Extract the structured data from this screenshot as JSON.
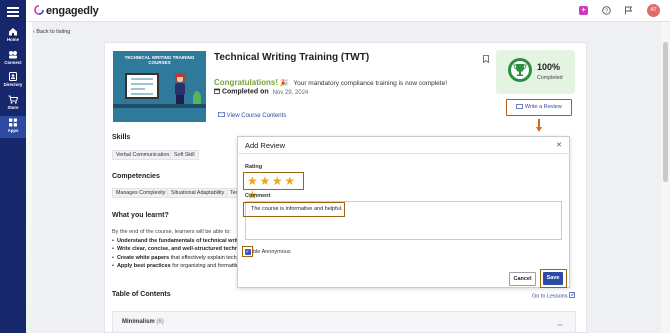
{
  "nav": {
    "items": [
      {
        "label": "Home"
      },
      {
        "label": "Connect"
      },
      {
        "label": "Directory"
      },
      {
        "label": "Store"
      },
      {
        "label": "Apps"
      }
    ]
  },
  "topbar": {
    "brand": "engagedly",
    "avatar_initials": "AT"
  },
  "back_link": "Back to listing",
  "course": {
    "thumbnail_title": "TECHNICAL WRITING TRAINING COURSES",
    "title": "Technical Writing Training (TWT)",
    "congrats_title": "Congratulations!",
    "congrats_msg": "Your mandatory compliance training is now complete!",
    "completed_label": "Completed on",
    "completed_date": "Nov 29, 2024",
    "view_contents": "View Course Contents",
    "progress_pct": "100%",
    "progress_label": "Completed",
    "write_review": "Write a Review"
  },
  "skills": {
    "heading": "Skills",
    "items": [
      "Verbal Communication",
      "Soft Skill"
    ]
  },
  "competencies": {
    "heading": "Competencies",
    "items": [
      "Manages Complexity",
      "Situational Adaptability",
      "Tec"
    ]
  },
  "learn": {
    "heading": "What you learnt?",
    "intro": "By the end of the course, learners will be able to:",
    "bullets": [
      {
        "bold": "Understand the fundamentals of technical writir",
        "rest": ""
      },
      {
        "bold": "Write clear, concise, and well-structured technic",
        "rest": ""
      },
      {
        "bold": "Create white papers",
        "rest": " that effectively explain tech"
      },
      {
        "bold": "Apply best practices",
        "rest": " for organizing and formattin"
      }
    ]
  },
  "toc": {
    "heading": "Table of Contents",
    "go_lessons": "Go to Lessons",
    "row_title": "Minimalism",
    "row_count": "(6)"
  },
  "modal": {
    "title": "Add Review",
    "rating_label": "Rating",
    "stars": [
      "★",
      "★",
      "★",
      "★",
      "★"
    ],
    "comment_label": "Comment",
    "comment_value": "The course is informative and helpful.",
    "anonymous_label": "ble Anonymous",
    "cancel": "Cancel",
    "save": "Save"
  },
  "colors": {
    "nav_bg": "#16286b",
    "accent": "#2d4aa6",
    "highlight": "#9c6516",
    "star": "#e9a81d",
    "success": "#2f8f40"
  }
}
